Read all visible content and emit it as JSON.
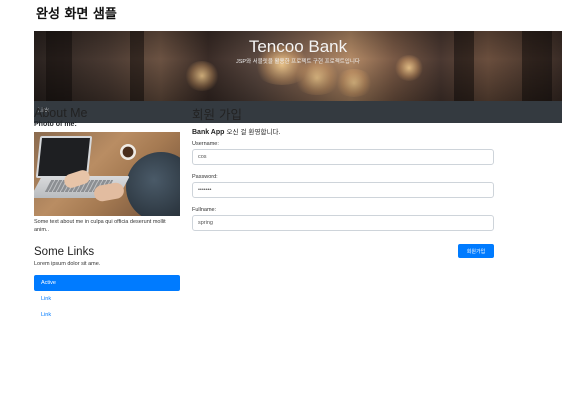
{
  "document": {
    "title": "완성 화면 샘플"
  },
  "jumbotron": {
    "title": "Tencoo Bank",
    "subtitle": "JSP와 서블릿을 활용한 프로젝트 구현 프로젝트입니다"
  },
  "navbar": {
    "link_label": "Link"
  },
  "about": {
    "heading": "About Me",
    "photo_label": "Photo of me:",
    "caption": "Some text about me in culpa qui officia deserunt mollit anim.."
  },
  "links": {
    "heading": "Some Links",
    "description": "Lorem ipsum dolor sit ame.",
    "items": [
      {
        "label": "Active"
      },
      {
        "label": "Link"
      },
      {
        "label": "Link"
      }
    ]
  },
  "form": {
    "heading": "회원 가입",
    "welcome_app": "Bank App",
    "welcome_rest": " 오신 걸 환영합니다.",
    "username_label": "Username:",
    "username_value": "cos",
    "password_label": "Password:",
    "password_value": "1234567",
    "fullname_label": "Fullname:",
    "fullname_value": "spring",
    "submit_label": "회원가입"
  },
  "colors": {
    "primary": "#007bff",
    "navbar": "#343a40"
  }
}
